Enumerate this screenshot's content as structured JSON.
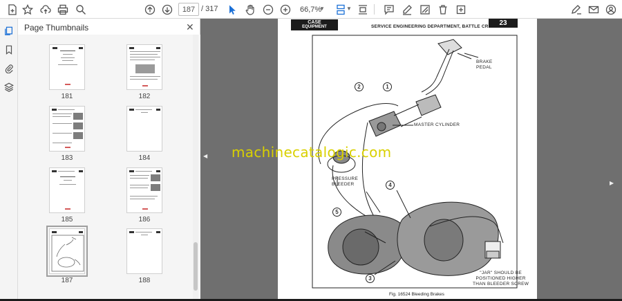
{
  "toolbar": {
    "current_page": "187",
    "total_pages": "/ 317",
    "zoom": "66,7%"
  },
  "panel": {
    "title": "Page Thumbnails",
    "close_glyph": "✕"
  },
  "thumbnails": [
    {
      "page": "181"
    },
    {
      "page": "182"
    },
    {
      "page": "183"
    },
    {
      "page": "184"
    },
    {
      "page": "185"
    },
    {
      "page": "186"
    },
    {
      "page": "187",
      "selected": true
    },
    {
      "page": "188"
    }
  ],
  "document": {
    "brand_line1": "CASE",
    "brand_line2": "EQUIPMENT",
    "department": "SERVICE ENGINEERING DEPARTMENT, BATTLE CREEK",
    "page_number": "23",
    "labels": {
      "brake_pedal": "BRAKE\nPEDAL",
      "master_cylinder": "MASTER CYLINDER",
      "pressure_bleeder": "PRESSURE\nBLEEDER",
      "jar_note": "\"JAR\" SHOULD BE\nPOSITIONED HIGHER\nTHAN BLEEDER SCREW"
    },
    "callouts": [
      "1",
      "2",
      "3",
      "4",
      "5"
    ],
    "caption": "Fig. 16524     Bleeding Brakes"
  },
  "watermark": "machinecatalogic.com",
  "colors": {
    "accent": "#1a6fd6",
    "watermark": "#d9d000",
    "doc_background": "#6f6f6f"
  },
  "icons": {
    "toolbar": [
      "star-icon",
      "upload-icon",
      "print-icon",
      "search-icon",
      "page-up-icon",
      "page-down-icon",
      "cursor-icon",
      "hand-icon",
      "zoom-out-icon",
      "zoom-in-icon",
      "fit-page-icon",
      "scroll-mode-icon",
      "comment-icon",
      "pen-icon",
      "highlight-icon",
      "delete-icon",
      "more-icon",
      "sign-icon",
      "email-icon",
      "account-icon"
    ],
    "rail": [
      "thumbnails-icon",
      "bookmark-icon",
      "attachment-icon",
      "layers-icon"
    ]
  }
}
